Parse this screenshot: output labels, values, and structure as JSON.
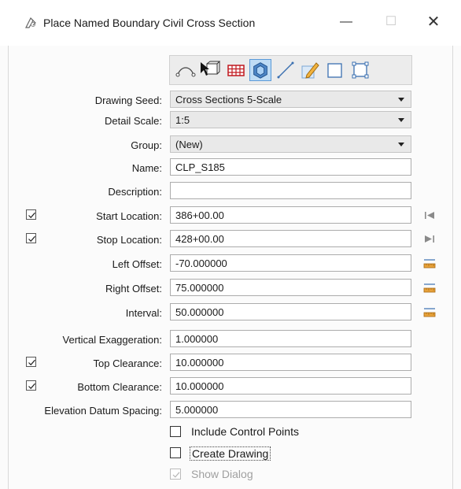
{
  "window": {
    "title": "Place Named Boundary Civil Cross Section",
    "minimize_glyph": "—",
    "maximize_glyph": "☐",
    "close_glyph": "✕"
  },
  "toolbar": {
    "tools": [
      "path-icon",
      "pointer-cube-icon",
      "grid-icon",
      "cross-section-icon",
      "line-icon",
      "pencil-icon",
      "rectangle-icon",
      "rectangle-corners-icon"
    ],
    "active_tool": "cross-section-icon"
  },
  "fields": {
    "drawing_seed": {
      "label": "Drawing Seed:",
      "value": "Cross Sections 5-Scale"
    },
    "detail_scale": {
      "label": "Detail Scale:",
      "value": "1:5"
    },
    "group": {
      "label": "Group:",
      "value": "(New)"
    },
    "name": {
      "label": "Name:",
      "value": "CLP_S185"
    },
    "description": {
      "label": "Description:",
      "value": ""
    },
    "start_location": {
      "label": "Start Location:",
      "value": "386+00.00",
      "checked": true
    },
    "stop_location": {
      "label": "Stop Location:",
      "value": "428+00.00",
      "checked": true
    },
    "left_offset": {
      "label": "Left Offset:",
      "value": "-70.000000"
    },
    "right_offset": {
      "label": "Right Offset:",
      "value": "75.000000"
    },
    "interval": {
      "label": "Interval:",
      "value": "50.000000"
    },
    "vertical_exaggeration": {
      "label": "Vertical Exaggeration:",
      "value": "1.000000"
    },
    "top_clearance": {
      "label": "Top Clearance:",
      "value": "10.000000",
      "checked": true
    },
    "bottom_clearance": {
      "label": "Bottom Clearance:",
      "value": "10.000000",
      "checked": true
    },
    "elevation_datum_spacing": {
      "label": "Elevation Datum Spacing:",
      "value": "5.000000"
    }
  },
  "options": {
    "include_control_points": {
      "label": "Include Control Points",
      "checked": false
    },
    "create_drawing": {
      "label": "Create Drawing",
      "checked": false
    },
    "show_dialog": {
      "label": "Show Dialog",
      "checked": true,
      "disabled": true
    }
  },
  "colors": {
    "active_tool_bg": "#bfdcf5",
    "accent": "#5a9ad8",
    "icon_orange": "#d08a1a"
  }
}
